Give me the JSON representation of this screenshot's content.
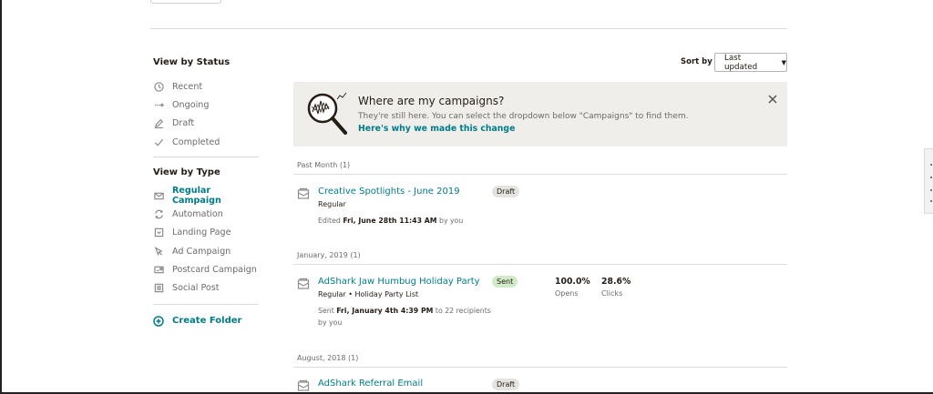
{
  "sidebar": {
    "status_heading": "View by Status",
    "status_items": [
      {
        "label": "Recent",
        "icon": "clock-icon"
      },
      {
        "label": "Ongoing",
        "icon": "arrow-right-icon"
      },
      {
        "label": "Draft",
        "icon": "pencil-icon"
      },
      {
        "label": "Completed",
        "icon": "check-icon"
      }
    ],
    "type_heading": "View by Type",
    "type_items": [
      {
        "label": "Regular Campaign",
        "icon": "envelope-icon",
        "active": true
      },
      {
        "label": "Automation",
        "icon": "refresh-icon"
      },
      {
        "label": "Landing Page",
        "icon": "landing-page-icon"
      },
      {
        "label": "Ad Campaign",
        "icon": "cursor-icon"
      },
      {
        "label": "Postcard Campaign",
        "icon": "postcard-icon"
      },
      {
        "label": "Social Post",
        "icon": "social-post-icon"
      }
    ],
    "create_folder": "Create Folder"
  },
  "sort": {
    "label": "Sort by",
    "selected": "Last updated"
  },
  "banner": {
    "title": "Where are my campaigns?",
    "body": "They're still here. You can select the dropdown below \"Campaigns\" to find them.",
    "link": "Here's why we made this change"
  },
  "groups": [
    {
      "heading": "Past Month (1)"
    },
    {
      "heading": "January, 2019 (1)"
    },
    {
      "heading": "August, 2018 (1)"
    }
  ],
  "campaigns": [
    {
      "title": "Creative Spotlights - June 2019",
      "type": "Regular",
      "status": "Draft",
      "meta_prefix": "Edited ",
      "meta_bold": "Fri, June 28th 11:43 AM",
      "meta_suffix": " by you"
    },
    {
      "title": "AdShark Jaw Humbug Holiday Party",
      "type": "Regular • Holiday Party List",
      "status": "Sent",
      "meta_prefix": "Sent ",
      "meta_bold": "Fri, January 4th 4:39 PM",
      "meta_suffix": " to 22 recipients by you",
      "opens_value": "100.0%",
      "opens_label": "Opens",
      "clicks_value": "28.6%",
      "clicks_label": "Clicks"
    },
    {
      "title": "AdShark Referral Email",
      "status": "Draft"
    }
  ],
  "colors": {
    "accent": "#007c89",
    "sent_badge": "#d1eac8",
    "draft_badge": "#e4e3df",
    "banner_bg": "#efeeea"
  }
}
